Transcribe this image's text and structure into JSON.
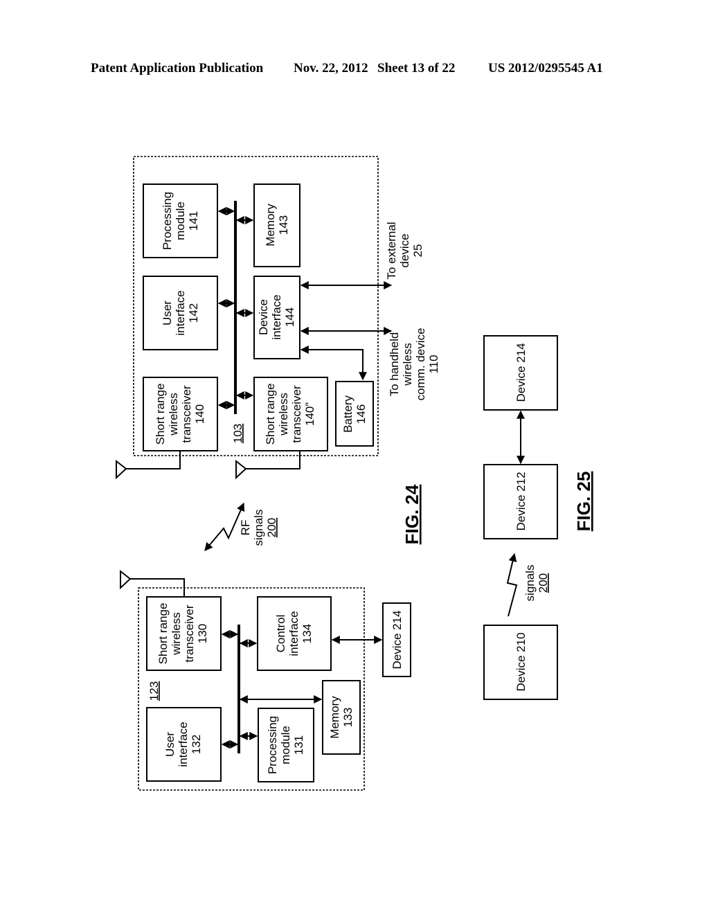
{
  "header": {
    "publication": "Patent Application Publication",
    "date": "Nov. 22, 2012",
    "sheet": "Sheet 13 of 22",
    "number": "US 2012/0295545 A1"
  },
  "fig24": {
    "caption": "FIG. 24",
    "device_103": {
      "ref": "103",
      "processing_module": [
        "Processing",
        "module",
        "141"
      ],
      "memory": [
        "Memory",
        "143"
      ],
      "user_interface": [
        "User",
        "interface",
        "142"
      ],
      "device_interface": [
        "Device",
        "interface",
        "144"
      ],
      "transceiver_140": [
        "Short range",
        "wireless",
        "transceiver",
        "140"
      ],
      "transceiver_140b": [
        "Short range",
        "wireless",
        "transceiver",
        "140”"
      ],
      "battery": [
        "Battery",
        "146"
      ],
      "to_external": [
        "To external",
        "device",
        "25"
      ],
      "to_handheld": [
        "To handheld",
        "wireless",
        "comm. device",
        "110"
      ]
    },
    "rf_signals": [
      "RF",
      "signals",
      "200"
    ],
    "device_123": {
      "ref": "123",
      "transceiver_130": [
        "Short range",
        "wireless",
        "transceiver",
        "130"
      ],
      "control_interface": [
        "Control",
        "interface",
        "134"
      ],
      "user_interface": [
        "User",
        "interface",
        "132"
      ],
      "processing_module": [
        "Processing",
        "module",
        "131"
      ],
      "memory": [
        "Memory",
        "133"
      ],
      "device_214": "Device 214"
    }
  },
  "fig25": {
    "caption": "FIG. 25",
    "device_210": "Device 210",
    "device_212": "Device 212",
    "device_214": "Device 214",
    "signals": [
      "signals",
      "200"
    ]
  }
}
